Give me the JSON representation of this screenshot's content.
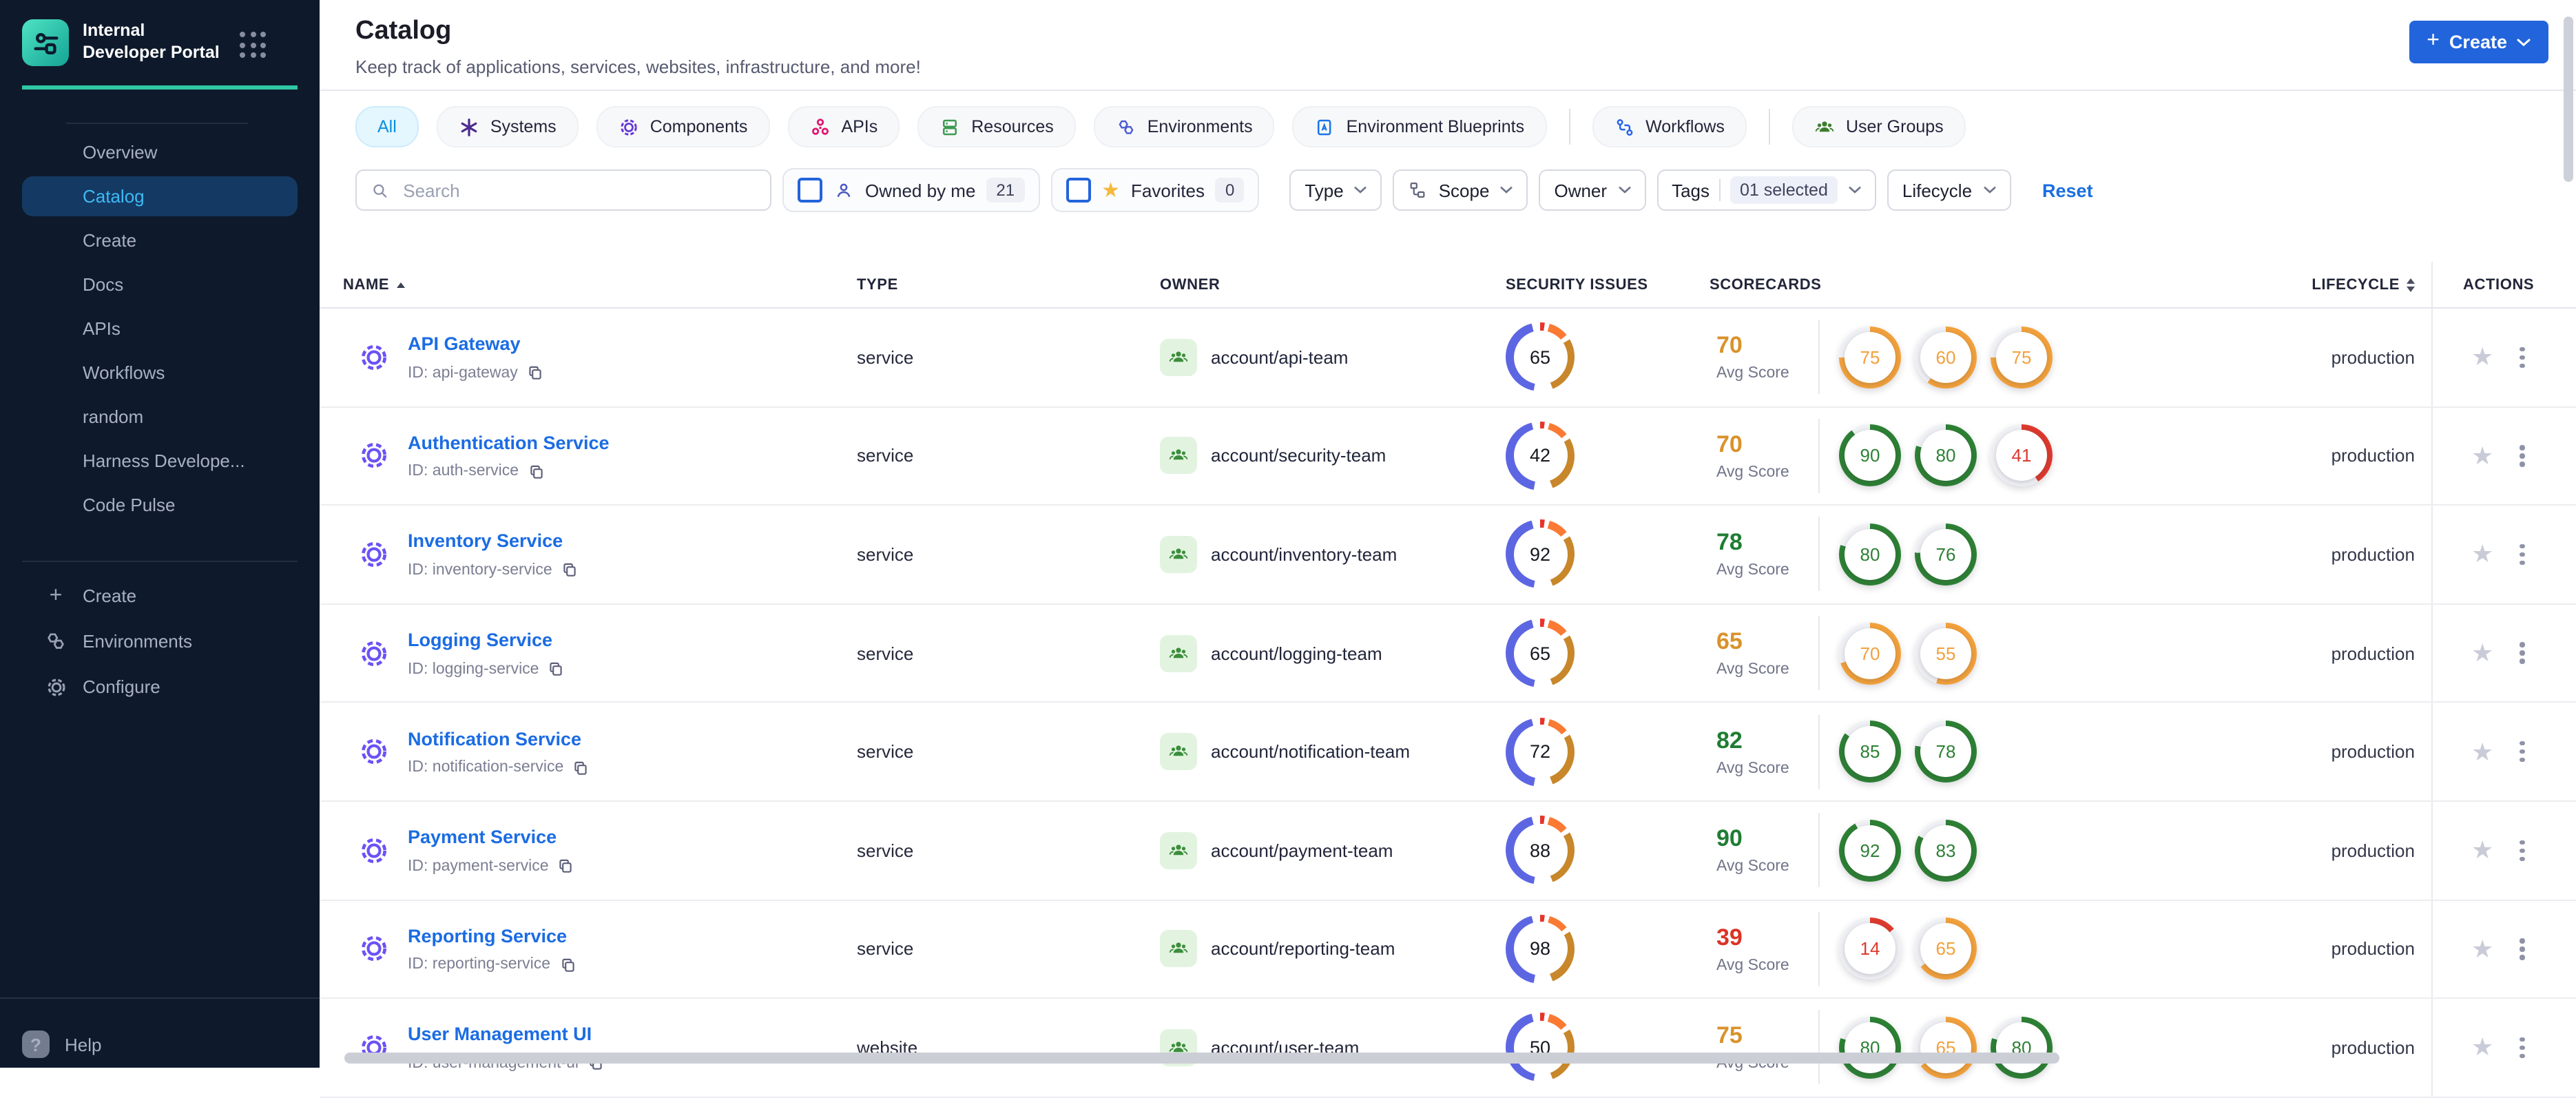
{
  "colors": {
    "accent": "#2264db",
    "link": "#1b6ce3",
    "sidebar_bg": "#0e1a2b",
    "sidebar_active_bg": "#143a63",
    "sidebar_active_text": "#3fb9f6",
    "brand_teal": "#2fc6a4",
    "tab_active_bg": "#e4f6fe",
    "tab_active_text": "#0b8fe0",
    "donut_blue": "#5d66e2",
    "donut_orange": "#fb7a33",
    "donut_gold": "#c8872b",
    "donut_red": "#e5352c"
  },
  "sidebar": {
    "brand_title": "Internal Developer Portal",
    "items": [
      {
        "label": "Overview",
        "active": false
      },
      {
        "label": "Catalog",
        "active": true
      },
      {
        "label": "Create",
        "active": false
      },
      {
        "label": "Docs",
        "active": false
      },
      {
        "label": "APIs",
        "active": false
      },
      {
        "label": "Workflows",
        "active": false
      },
      {
        "label": "random",
        "active": false
      },
      {
        "label": "Harness Develope...",
        "active": false
      },
      {
        "label": "Code Pulse",
        "active": false
      }
    ],
    "footer_items": {
      "create": "Create",
      "environments": "Environments",
      "configure": "Configure"
    },
    "help_label": "Help"
  },
  "header": {
    "title": "Catalog",
    "subtitle": "Keep track of applications, services, websites, infrastructure, and more!",
    "create_button": "Create"
  },
  "tabs": [
    {
      "label": "All"
    },
    {
      "label": "Systems"
    },
    {
      "label": "Components"
    },
    {
      "label": "APIs"
    },
    {
      "label": "Resources"
    },
    {
      "label": "Environments"
    },
    {
      "label": "Environment Blueprints"
    },
    {
      "label": "Workflows"
    },
    {
      "label": "User Groups"
    }
  ],
  "filters": {
    "search_placeholder": "Search",
    "owned_by_me": "Owned by me",
    "owned_count": "21",
    "favorites": "Favorites",
    "favorites_count": "0",
    "type": "Type",
    "scope": "Scope",
    "owner": "Owner",
    "tags": "Tags",
    "tags_selected": "01 selected",
    "lifecycle": "Lifecycle",
    "reset": "Reset"
  },
  "table": {
    "columns": {
      "name": "NAME",
      "type": "TYPE",
      "owner": "OWNER",
      "security": "SECURITY ISSUES",
      "scorecards": "SCORECARDS",
      "lifecycle": "LIFECYCLE",
      "actions": "ACTIONS"
    },
    "avg_label": "Avg Score",
    "rows": [
      {
        "name": "API Gateway",
        "id_label": "ID: api-gateway",
        "type": "service",
        "owner": "account/api-team",
        "security": "65",
        "avg": "70",
        "avg_color": "#d9922b",
        "lifecycle": "production",
        "cards": [
          {
            "value": 75,
            "color": "#f2a13c"
          },
          {
            "value": 60,
            "color": "#f2a13c"
          },
          {
            "value": 75,
            "color": "#f2a13c"
          }
        ]
      },
      {
        "name": "Authentication Service",
        "id_label": "ID: auth-service",
        "type": "service",
        "owner": "account/security-team",
        "security": "42",
        "avg": "70",
        "avg_color": "#d9922b",
        "lifecycle": "production",
        "cards": [
          {
            "value": 90,
            "color": "#2d8034"
          },
          {
            "value": 80,
            "color": "#2d8034"
          },
          {
            "value": 41,
            "color": "#dd3a2e"
          }
        ]
      },
      {
        "name": "Inventory Service",
        "id_label": "ID: inventory-service",
        "type": "service",
        "owner": "account/inventory-team",
        "security": "92",
        "avg": "78",
        "avg_color": "#1f7d33",
        "lifecycle": "production",
        "cards": [
          {
            "value": 80,
            "color": "#2d8034"
          },
          {
            "value": 76,
            "color": "#2d8034"
          }
        ]
      },
      {
        "name": "Logging Service",
        "id_label": "ID: logging-service",
        "type": "service",
        "owner": "account/logging-team",
        "security": "65",
        "avg": "65",
        "avg_color": "#d9922b",
        "lifecycle": "production",
        "cards": [
          {
            "value": 70,
            "color": "#f2a13c"
          },
          {
            "value": 55,
            "color": "#f2a13c"
          }
        ]
      },
      {
        "name": "Notification Service",
        "id_label": "ID: notification-service",
        "type": "service",
        "owner": "account/notification-team",
        "security": "72",
        "avg": "82",
        "avg_color": "#1f7d33",
        "lifecycle": "production",
        "cards": [
          {
            "value": 85,
            "color": "#2d8034"
          },
          {
            "value": 78,
            "color": "#2d8034"
          }
        ]
      },
      {
        "name": "Payment Service",
        "id_label": "ID: payment-service",
        "type": "service",
        "owner": "account/payment-team",
        "security": "88",
        "avg": "90",
        "avg_color": "#1f7d33",
        "lifecycle": "production",
        "cards": [
          {
            "value": 92,
            "color": "#2d8034"
          },
          {
            "value": 83,
            "color": "#2d8034"
          }
        ]
      },
      {
        "name": "Reporting Service",
        "id_label": "ID: reporting-service",
        "type": "service",
        "owner": "account/reporting-team",
        "security": "98",
        "avg": "39",
        "avg_color": "#da3427",
        "lifecycle": "production",
        "cards": [
          {
            "value": 14,
            "color": "#dd3a2e"
          },
          {
            "value": 65,
            "color": "#f2a13c"
          }
        ]
      },
      {
        "name": "User Management UI",
        "id_label": "ID: user-management-ui",
        "type": "website",
        "owner": "account/user-team",
        "security": "50",
        "avg": "75",
        "avg_color": "#d9922b",
        "lifecycle": "production",
        "cards": [
          {
            "value": 80,
            "color": "#2d8034"
          },
          {
            "value": 65,
            "color": "#f2a13c"
          },
          {
            "value": 80,
            "color": "#2d8034"
          }
        ]
      }
    ]
  }
}
